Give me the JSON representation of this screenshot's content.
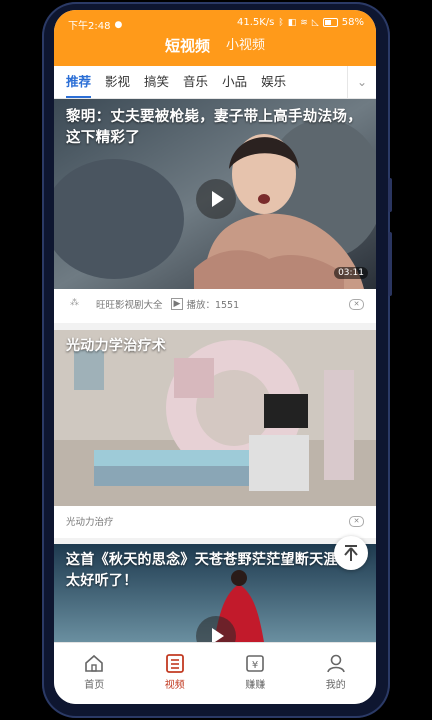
{
  "status": {
    "time": "下午2:48",
    "network_speed": "41.5K/s",
    "battery": "58%"
  },
  "top_tabs": [
    {
      "label": "短视频",
      "active": true
    },
    {
      "label": "小视频",
      "active": false
    }
  ],
  "categories": [
    "推荐",
    "影视",
    "搞笑",
    "音乐",
    "小品",
    "娱乐"
  ],
  "active_category": "推荐",
  "feed": [
    {
      "title": "黎明：丈夫要被枪毙，妻子带上高手劫法场，这下精彩了",
      "duration": "03:11",
      "source": "旺旺影视剧大全",
      "plays_label": "播放：1551"
    },
    {
      "title": "光动力学治疗术",
      "source": "光动力治疗"
    },
    {
      "title": "这首《秋天的思念》天苍苍野茫茫望断天涯，太好听了！"
    }
  ],
  "bottom_nav": [
    {
      "label": "首页",
      "icon": "home-icon",
      "active": false
    },
    {
      "label": "视频",
      "icon": "video-icon",
      "active": true
    },
    {
      "label": "赚赚",
      "icon": "earn-icon",
      "active": false
    },
    {
      "label": "我的",
      "icon": "profile-icon",
      "active": false
    }
  ],
  "colors": {
    "header": "#ff9a1a",
    "tab_active": "#2c6fd6",
    "nav_active": "#c23b22"
  }
}
